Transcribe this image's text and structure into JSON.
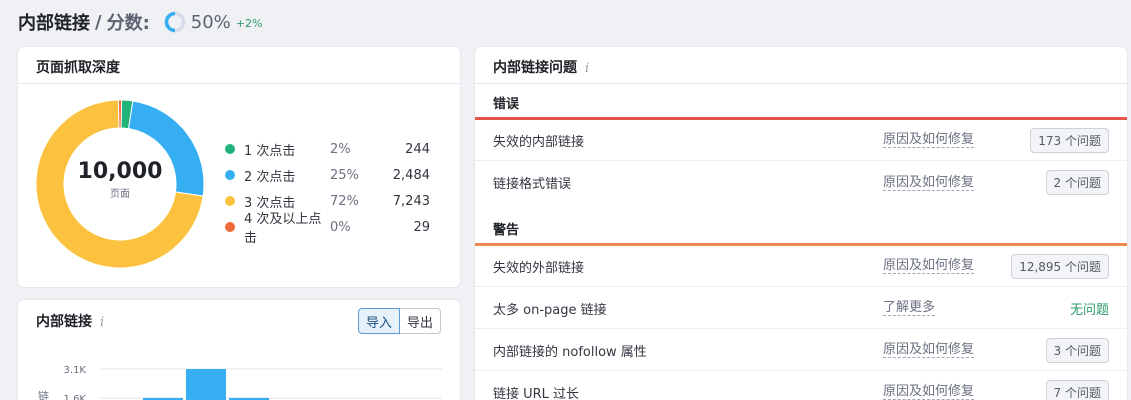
{
  "header": {
    "title": "内部链接",
    "separator": "/",
    "subtitle": "分数:",
    "score": "50%",
    "score_fraction": 0.5,
    "delta": "+2%"
  },
  "crawl_depth": {
    "title": "页面抓取深度",
    "total": "10,000",
    "total_label": "页面",
    "legend": [
      {
        "label": "1 次点击",
        "percent": "2%",
        "count": "244",
        "color": "#20b37a"
      },
      {
        "label": "2 次点击",
        "percent": "25%",
        "count": "2,484",
        "color": "#35aff2"
      },
      {
        "label": "3 次点击",
        "percent": "72%",
        "count": "7,243",
        "color": "#fcc23f"
      },
      {
        "label": "4 次及以上点击",
        "percent": "0%",
        "count": "29",
        "color": "#ee6a3a"
      }
    ],
    "chart_data": {
      "type": "pie",
      "categories": [
        "1 次点击",
        "2 次点击",
        "3 次点击",
        "4 次及以上点击"
      ],
      "values": [
        244,
        2484,
        7243,
        29
      ],
      "colors": [
        "#20b37a",
        "#35aff2",
        "#fcc23f",
        "#ee6a3a"
      ]
    }
  },
  "internal_links": {
    "title": "内部链接",
    "info": "i",
    "import_label": "导入",
    "export_label": "导出",
    "chart_data": {
      "type": "bar",
      "ytick_labels": [
        "3.1K",
        "1.6K"
      ],
      "ylabel": "链",
      "values": [
        1600,
        3100,
        1600
      ],
      "color": "#35aff2"
    }
  },
  "issues": {
    "title": "内部链接问题",
    "info": "i",
    "errors_label": "错误",
    "warnings_label": "警告",
    "error_color": "#e5534b",
    "warning_color": "#f0884f",
    "errors": [
      {
        "name": "失效的内部链接",
        "action": "原因及如何修复",
        "badge": "173 个问题"
      },
      {
        "name": "链接格式错误",
        "action": "原因及如何修复",
        "badge": "2 个问题"
      }
    ],
    "warnings": [
      {
        "name": "失效的外部链接",
        "action": "原因及如何修复",
        "badge": "12,895 个问题"
      },
      {
        "name": "太多 on-page 链接",
        "action": "了解更多",
        "status": "无问题"
      },
      {
        "name": "内部链接的 nofollow 属性",
        "action": "原因及如何修复",
        "badge": "3 个问题"
      },
      {
        "name": "链接 URL 过长",
        "action": "原因及如何修复",
        "badge": "7 个问题"
      }
    ]
  }
}
